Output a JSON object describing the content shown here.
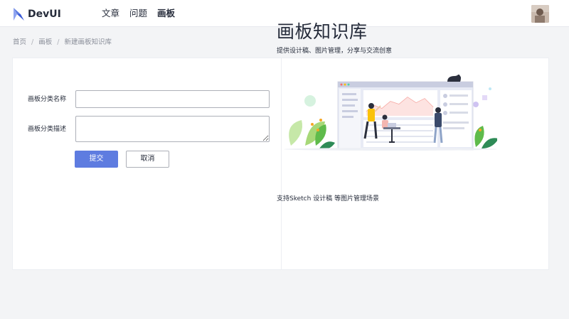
{
  "brand": {
    "name": "DevUI"
  },
  "nav": {
    "items": [
      "文章",
      "问题",
      "画板"
    ],
    "active_index": 2
  },
  "breadcrumb": [
    "首页",
    "画板",
    "新建画板知识库"
  ],
  "form": {
    "name_label": "画板分类名称",
    "name_value": "",
    "desc_label": "画板分类描述",
    "desc_value": "",
    "submit_label": "提交",
    "cancel_label": "取消"
  },
  "hero": {
    "title": "画板知识库",
    "subtitle": "提供设计稿、图片管理，分享与交流创意",
    "footer": "支持Sketch 设计稿 等图片管理场景"
  },
  "colors": {
    "primary": "#5e7ce0",
    "page_bg": "#f3f4f6",
    "text": "#252b3a"
  }
}
